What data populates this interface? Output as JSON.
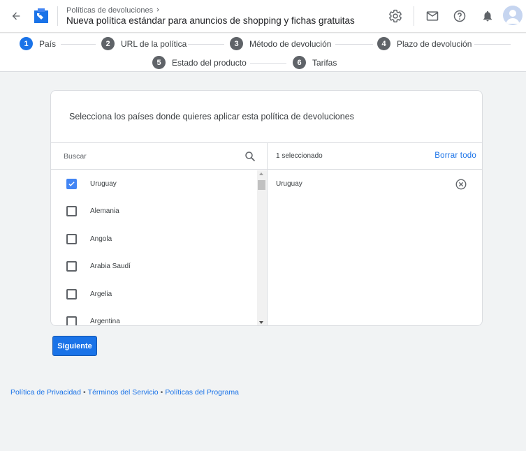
{
  "header": {
    "breadcrumb": "Políticas de devoluciones",
    "title": "Nueva política estándar para anuncios de shopping y fichas gratuitas",
    "icons": [
      "back-arrow-icon",
      "settings-icon",
      "mail-icon",
      "help-icon",
      "notifications-icon",
      "account-avatar"
    ]
  },
  "stepper": {
    "steps": [
      {
        "num": "1",
        "label": "País",
        "active": true
      },
      {
        "num": "2",
        "label": "URL de la política",
        "active": false
      },
      {
        "num": "3",
        "label": "Método de devolución",
        "active": false
      },
      {
        "num": "4",
        "label": "Plazo de devolución",
        "active": false
      },
      {
        "num": "5",
        "label": "Estado del producto",
        "active": false
      },
      {
        "num": "6",
        "label": "Tarifas",
        "active": false
      }
    ]
  },
  "card": {
    "heading": "Selecciona los países donde quieres aplicar esta política de devoluciones",
    "search_placeholder": "Buscar",
    "countries": [
      {
        "label": "Uruguay",
        "checked": true
      },
      {
        "label": "Alemania",
        "checked": false
      },
      {
        "label": "Angola",
        "checked": false
      },
      {
        "label": "Arabia Saudí",
        "checked": false
      },
      {
        "label": "Argelia",
        "checked": false
      },
      {
        "label": "Argentina",
        "checked": false
      }
    ],
    "selected_count": "1 seleccionado",
    "clear_all": "Borrar todo",
    "selected_items": [
      "Uruguay"
    ]
  },
  "actions": {
    "next_label": "Siguiente"
  },
  "footer": {
    "privacy": "Política de Privacidad",
    "terms": "Términos del Servicio",
    "program": "Políticas del Programa",
    "separator": "•"
  },
  "colors": {
    "accent": "#1a73e8",
    "checkbox_checked": "#4285f4",
    "step_inactive": "#5f6368",
    "background": "#f1f3f4"
  }
}
